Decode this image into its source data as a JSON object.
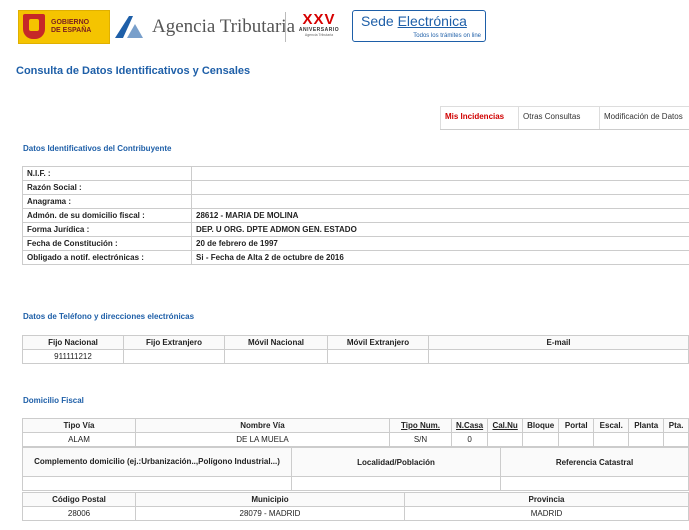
{
  "header": {
    "gob_logo_text": "GOBIERNO\nDE ESPAÑA",
    "agency_name": "Agencia Tributaria",
    "xxv_title": "XXV",
    "xxv_sub": "ANIVERSARIO",
    "xxv_sub2": "Agencia Tributaria",
    "sede_title_1": "Sede ",
    "sede_title_2": "Electrónica",
    "sede_subtitle": "Todos los trámites on line"
  },
  "page_title": "Consulta de Datos Identificativos y Censales",
  "tabs": [
    {
      "label": "Mis Incidencias",
      "active": true
    },
    {
      "label": "Otras Consultas",
      "active": false
    },
    {
      "label": "Modificación de Datos",
      "active": false
    }
  ],
  "ident": {
    "title": "Datos Identificativos del Contribuyente",
    "rows": [
      {
        "label": "N.I.F. :",
        "value": ""
      },
      {
        "label": "Razón Social :",
        "value": ""
      },
      {
        "label": "Anagrama :",
        "value": ""
      },
      {
        "label": "Admón. de su domicilio fiscal :",
        "value": "28612 - MARIA DE MOLINA"
      },
      {
        "label": "Forma Jurídica :",
        "value": "DEP. U ORG. DPTE ADMON GEN. ESTADO"
      },
      {
        "label": "Fecha de Constitución :",
        "value": "20 de febrero de 1997"
      },
      {
        "label": "Obligado a notif. electrónicas :",
        "value": "Si - Fecha de Alta 2 de octubre de 2016"
      }
    ]
  },
  "telefono": {
    "title": "Datos de Teléfono y direcciones electrónicas",
    "headers": [
      "Fijo Nacional",
      "Fijo Extranjero",
      "Móvil Nacional",
      "Móvil Extranjero",
      "E-mail"
    ],
    "values": [
      "911111212",
      "",
      "",
      "",
      ""
    ]
  },
  "domicilio": {
    "title": "Domicilio Fiscal",
    "h1": [
      "Tipo Vía",
      "Nombre Vía",
      "Tipo Num.",
      "N.Casa",
      "Cal.Nu",
      "Bloque",
      "Portal",
      "Escal.",
      "Planta",
      "Pta."
    ],
    "r1": [
      "ALAM",
      "DE LA MUELA",
      "S/N",
      "0",
      "",
      "",
      "",
      "",
      "",
      ""
    ],
    "h2": [
      "Complemento domicilio (ej.:Urbanización..,Polígono Industrial...)",
      "Localidad/Población",
      "Referencia Catastral"
    ],
    "r2": [
      "",
      "",
      ""
    ],
    "h3": [
      "Código Postal",
      "Municipio",
      "Provincia"
    ],
    "r3": [
      "28006",
      "28079 - MADRID",
      "MADRID"
    ]
  }
}
